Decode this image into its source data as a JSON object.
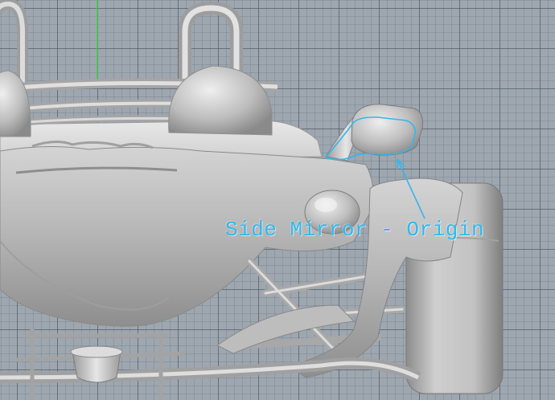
{
  "viewport": {
    "annotation": {
      "label": "Side Mirror - Origin",
      "color": "#2fb9ee"
    },
    "axis_color": "#3dcf4a",
    "grid_color": "#5f6a75",
    "model_color": "#c9c9c9"
  }
}
